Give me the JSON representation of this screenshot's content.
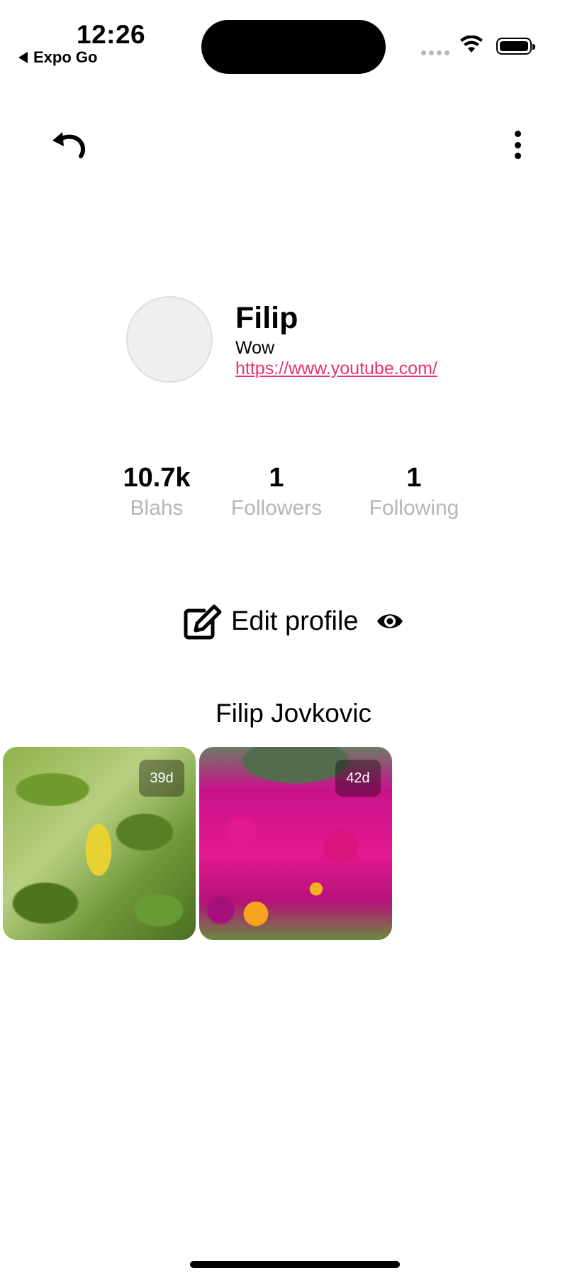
{
  "status_bar": {
    "time": "12:26",
    "back_app": "Expo Go"
  },
  "profile": {
    "name": "Filip",
    "bio": "Wow",
    "link": "https://www.youtube.com/",
    "full_name": "Filip Jovkovic"
  },
  "stats": [
    {
      "value": "10.7k",
      "label": "Blahs"
    },
    {
      "value": "1",
      "label": "Followers"
    },
    {
      "value": "1",
      "label": "Following"
    }
  ],
  "actions": {
    "edit_label": "Edit profile"
  },
  "posts": [
    {
      "age": "39d",
      "subject": "green leaves with yellow leaf"
    },
    {
      "age": "42d",
      "subject": "pink and orange flowers"
    }
  ],
  "colors": {
    "link": "#e8336b",
    "stat_label": "#b6b6b6"
  }
}
